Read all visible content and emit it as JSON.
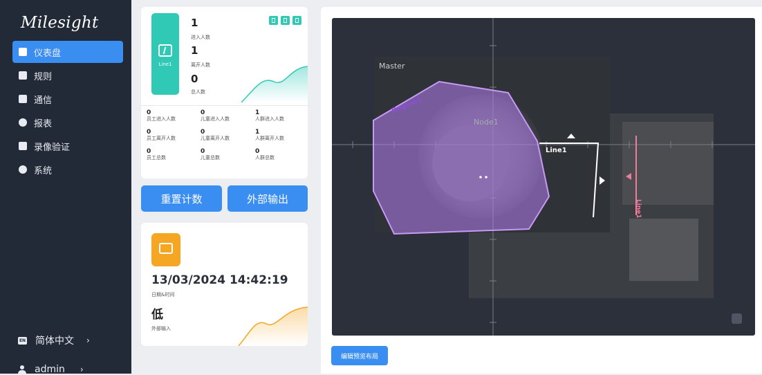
{
  "sidebar": {
    "logo": "Milesight",
    "items": [
      {
        "label": "仪表盘",
        "icon": "chart-icon",
        "active": true
      },
      {
        "label": "规则",
        "icon": "list-icon",
        "active": false
      },
      {
        "label": "通信",
        "icon": "card-icon",
        "active": false
      },
      {
        "label": "报表",
        "icon": "pie-icon",
        "active": false
      },
      {
        "label": "录像验证",
        "icon": "play-icon",
        "active": false
      },
      {
        "label": "系统",
        "icon": "gear-icon",
        "active": false
      }
    ],
    "language": {
      "tag": "EN",
      "label": "简体中文",
      "chevron": "›"
    },
    "user": {
      "label": "admin",
      "chevron": "›"
    }
  },
  "counter": {
    "line_label": "Line1",
    "enter_count": "1",
    "enter_label": "进入人数",
    "leave_count": "1",
    "leave_label": "离开人数",
    "total_count": "0",
    "total_label": "总人数",
    "details": [
      {
        "value": "0",
        "label": "员工进入人数"
      },
      {
        "value": "0",
        "label": "儿童进入人数"
      },
      {
        "value": "1",
        "label": "人群进入人数"
      },
      {
        "value": "0",
        "label": "员工离开人数"
      },
      {
        "value": "0",
        "label": "儿童离开人数"
      },
      {
        "value": "1",
        "label": "人群离开人数"
      },
      {
        "value": "0",
        "label": "员工总数"
      },
      {
        "value": "0",
        "label": "儿童总数"
      },
      {
        "value": "0",
        "label": "人群总数"
      }
    ],
    "accent": "#30c9b6"
  },
  "actions": {
    "reset_label": "重置计数",
    "output_label": "外部输出"
  },
  "io": {
    "datetime": "13/03/2024 14:42:19",
    "datetime_label": "日期&时间",
    "state": "低",
    "state_label": "外部输入",
    "accent": "#f5a623"
  },
  "preview": {
    "master_label": "Master",
    "node_label": "Node1",
    "region_label": "Region1",
    "line1_label": "Line1",
    "line2_label": "Line1",
    "edit_label": "编辑预览布局",
    "region_color": "#b57ef0",
    "line2_color": "#f07b9a"
  },
  "colors": {
    "primary": "#3a8ef2",
    "sidebar": "#222a37"
  }
}
